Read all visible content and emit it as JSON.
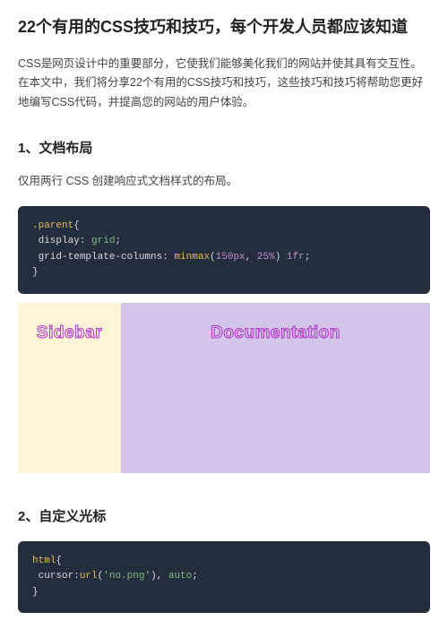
{
  "title": "22个有用的CSS技巧和技巧，每个开发人员都应该知道",
  "intro": "CSS是网页设计中的重要部分，它使我们能够美化我们的网站并使其具有交互性。在本文中，我们将分享22个有用的CSS技巧和技巧，这些技巧和技巧将帮助您更好地编写CSS代码，并提高您的网站的用户体验。",
  "section1": {
    "heading": "1、文档布局",
    "desc": "仅用两行 CSS 创建响应式文档样式的布局。",
    "code": {
      "selector": ".parent",
      "prop1": "display",
      "val1": "grid",
      "prop2": "grid-template-columns",
      "fn": "minmax",
      "arg1": "150px",
      "arg2": "25%",
      "tail": "1fr"
    },
    "demo": {
      "sidebar_label": "Sidebar",
      "main_label": "Documentation"
    }
  },
  "section2": {
    "heading": "2、自定义光标",
    "code": {
      "selector": "html",
      "prop": "cursor",
      "fn": "url",
      "arg": "'no.png'",
      "tail": "auto"
    }
  }
}
